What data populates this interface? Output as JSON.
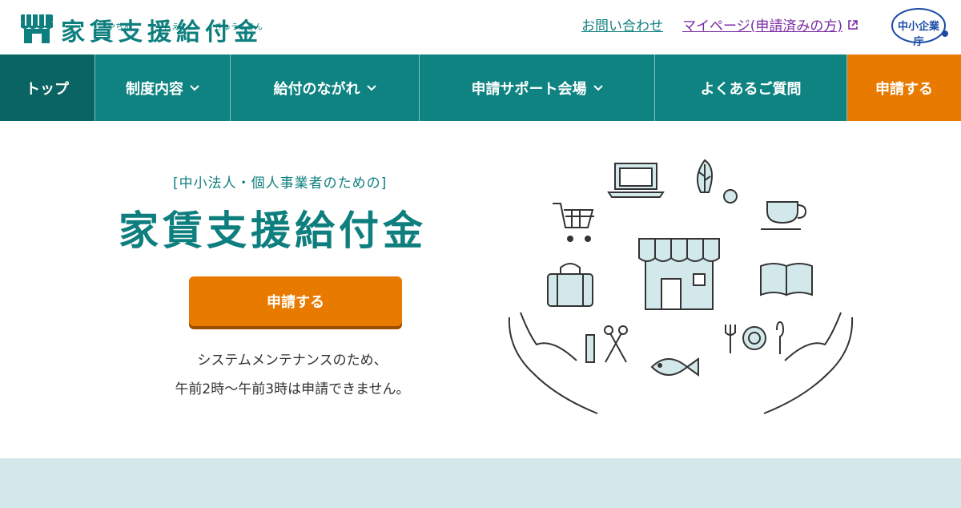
{
  "header": {
    "logo_title": "家賃支援給付金",
    "logo_ruby": [
      "やちん",
      "しえん",
      "きゅうふきん"
    ],
    "contact_link": "お問い合わせ",
    "mypage_link": "マイページ(申請済みの方)",
    "agency_label": "中小企業庁"
  },
  "nav": {
    "items": [
      {
        "label": "トップ"
      },
      {
        "label": "制度内容"
      },
      {
        "label": "給付のながれ"
      },
      {
        "label": "申請サポート会場"
      },
      {
        "label": "よくあるご質問"
      },
      {
        "label": "申請する"
      }
    ]
  },
  "hero": {
    "subtitle": "[中小法人・個人事業者のための]",
    "title": "家賃支援給付金",
    "button_label": "申請する",
    "note_line1": "システムメンテナンスのため、",
    "note_line2": "午前2時〜午前3時は申請できません。"
  },
  "colors": {
    "brand_teal": "#0e8381",
    "nav_top_dark": "#0a6463",
    "accent_orange": "#e87a00",
    "band_light": "#d3e8ea"
  }
}
